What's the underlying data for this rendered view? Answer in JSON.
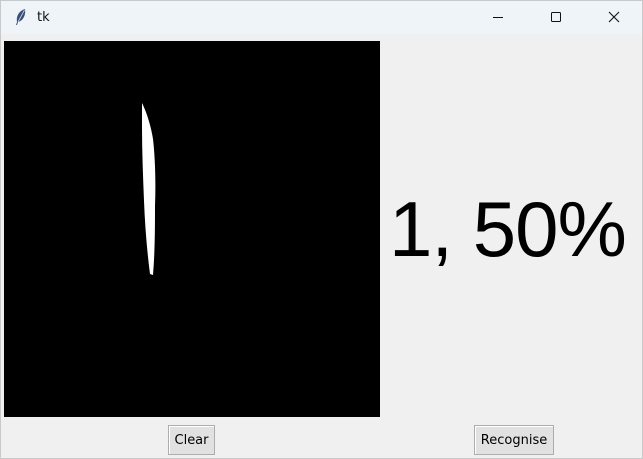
{
  "window": {
    "title": "tk",
    "icons": {
      "app": "feather-icon",
      "minimize": "minimize-icon",
      "maximize": "maximize-icon",
      "close": "close-icon"
    }
  },
  "canvas": {
    "background": "#000000",
    "stroke_color": "#ffffff"
  },
  "result": {
    "text": "1, 50%"
  },
  "buttons": {
    "clear_label": "Clear",
    "recognise_label": "Recognise"
  }
}
